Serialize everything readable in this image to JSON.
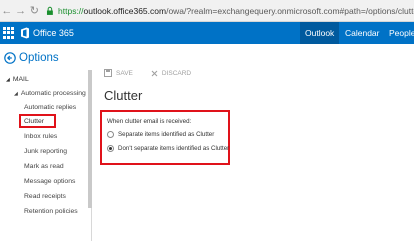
{
  "browser": {
    "url_scheme": "https://",
    "url_domain": "outlook.office365.com",
    "url_rest": "/owa/?realm=exchangequery.onmicrosoft.com#path=/options/clutter"
  },
  "header": {
    "product": "Office 365",
    "nav": [
      "Outlook",
      "Calendar",
      "People"
    ],
    "active_nav": "Outlook",
    "bg_color": "#0072c6"
  },
  "page": {
    "title": "Options"
  },
  "sidebar": {
    "section": "MAIL",
    "group": "Automatic processing",
    "items": [
      "Automatic replies",
      "Clutter",
      "Inbox rules",
      "Junk reporting",
      "Mark as read",
      "Message options",
      "Read receipts",
      "Retention policies"
    ],
    "selected": "Clutter"
  },
  "toolbar": {
    "save": "SAVE",
    "discard": "DISCARD"
  },
  "main": {
    "title": "Clutter",
    "question": "When clutter email is received:",
    "options": [
      "Separate items identified as Clutter",
      "Don't separate items identified as Clutter"
    ],
    "selected_option_index": 1
  },
  "colors": {
    "highlight": "#e0121a",
    "accent": "#0072c6"
  }
}
